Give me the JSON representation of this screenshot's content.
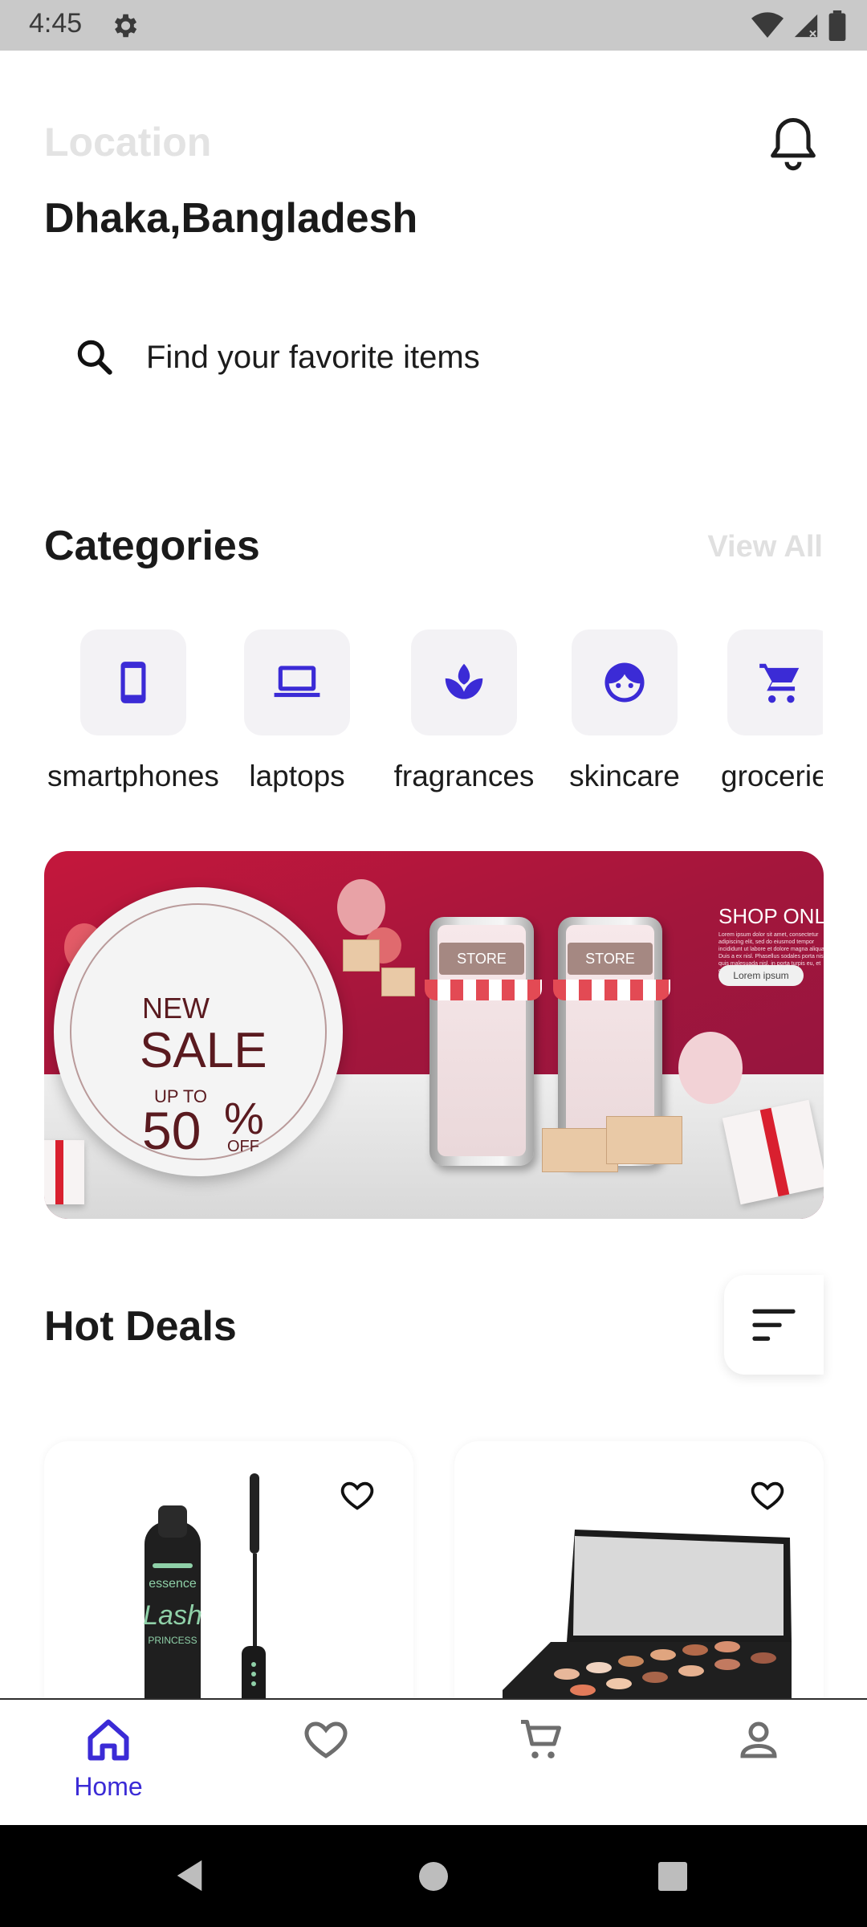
{
  "status_bar": {
    "time": "4:45"
  },
  "header": {
    "location_label": "Location",
    "location_value": "Dhaka,Bangladesh"
  },
  "search": {
    "placeholder": "Find your favorite items"
  },
  "categories": {
    "title": "Categories",
    "view_all": "View All",
    "items": [
      {
        "label": "smartphones",
        "icon": "smartphone-icon"
      },
      {
        "label": "laptops",
        "icon": "laptop-icon"
      },
      {
        "label": "fragrances",
        "icon": "spa-icon"
      },
      {
        "label": "skincare",
        "icon": "face-icon"
      },
      {
        "label": "groceries",
        "icon": "cart-icon"
      }
    ]
  },
  "banner": {
    "badge_new": "NEW",
    "badge_sale": "SALE",
    "badge_upto": "UP TO",
    "badge_value": "50",
    "badge_percent": "%",
    "badge_off": "OFF",
    "store_sign": "STORE",
    "shop_title": "SHOP ONLINE",
    "shop_body": "Lorem ipsum dolor sit amet, consectetur adipiscing elit, sed do eiusmod tempor incididunt ut labore et dolore magna aliqua. Duis a ex nisl. Phasellus sodales porta nisi, quis malesuada nisl, in porta turpis eu, et commodo.",
    "shop_button": "Lorem ipsum"
  },
  "hot_deals": {
    "title": "Hot Deals",
    "products": [
      {
        "image": "mascara",
        "brand_text": "essence",
        "product_text": "Lash",
        "sub_text": "PRINCESS"
      },
      {
        "image": "eyeshadow-palette"
      }
    ]
  },
  "bottom_nav": {
    "items": [
      {
        "label": "Home",
        "icon": "home-icon",
        "active": true
      },
      {
        "label": "",
        "icon": "heart-icon",
        "active": false
      },
      {
        "label": "",
        "icon": "cart-icon",
        "active": false
      },
      {
        "label": "",
        "icon": "person-icon",
        "active": false
      }
    ]
  },
  "colors": {
    "accent": "#3b2bd6",
    "banner_red": "#b3163b",
    "tile_bg": "#f3f2f5",
    "muted_text": "#e3e3e3"
  }
}
